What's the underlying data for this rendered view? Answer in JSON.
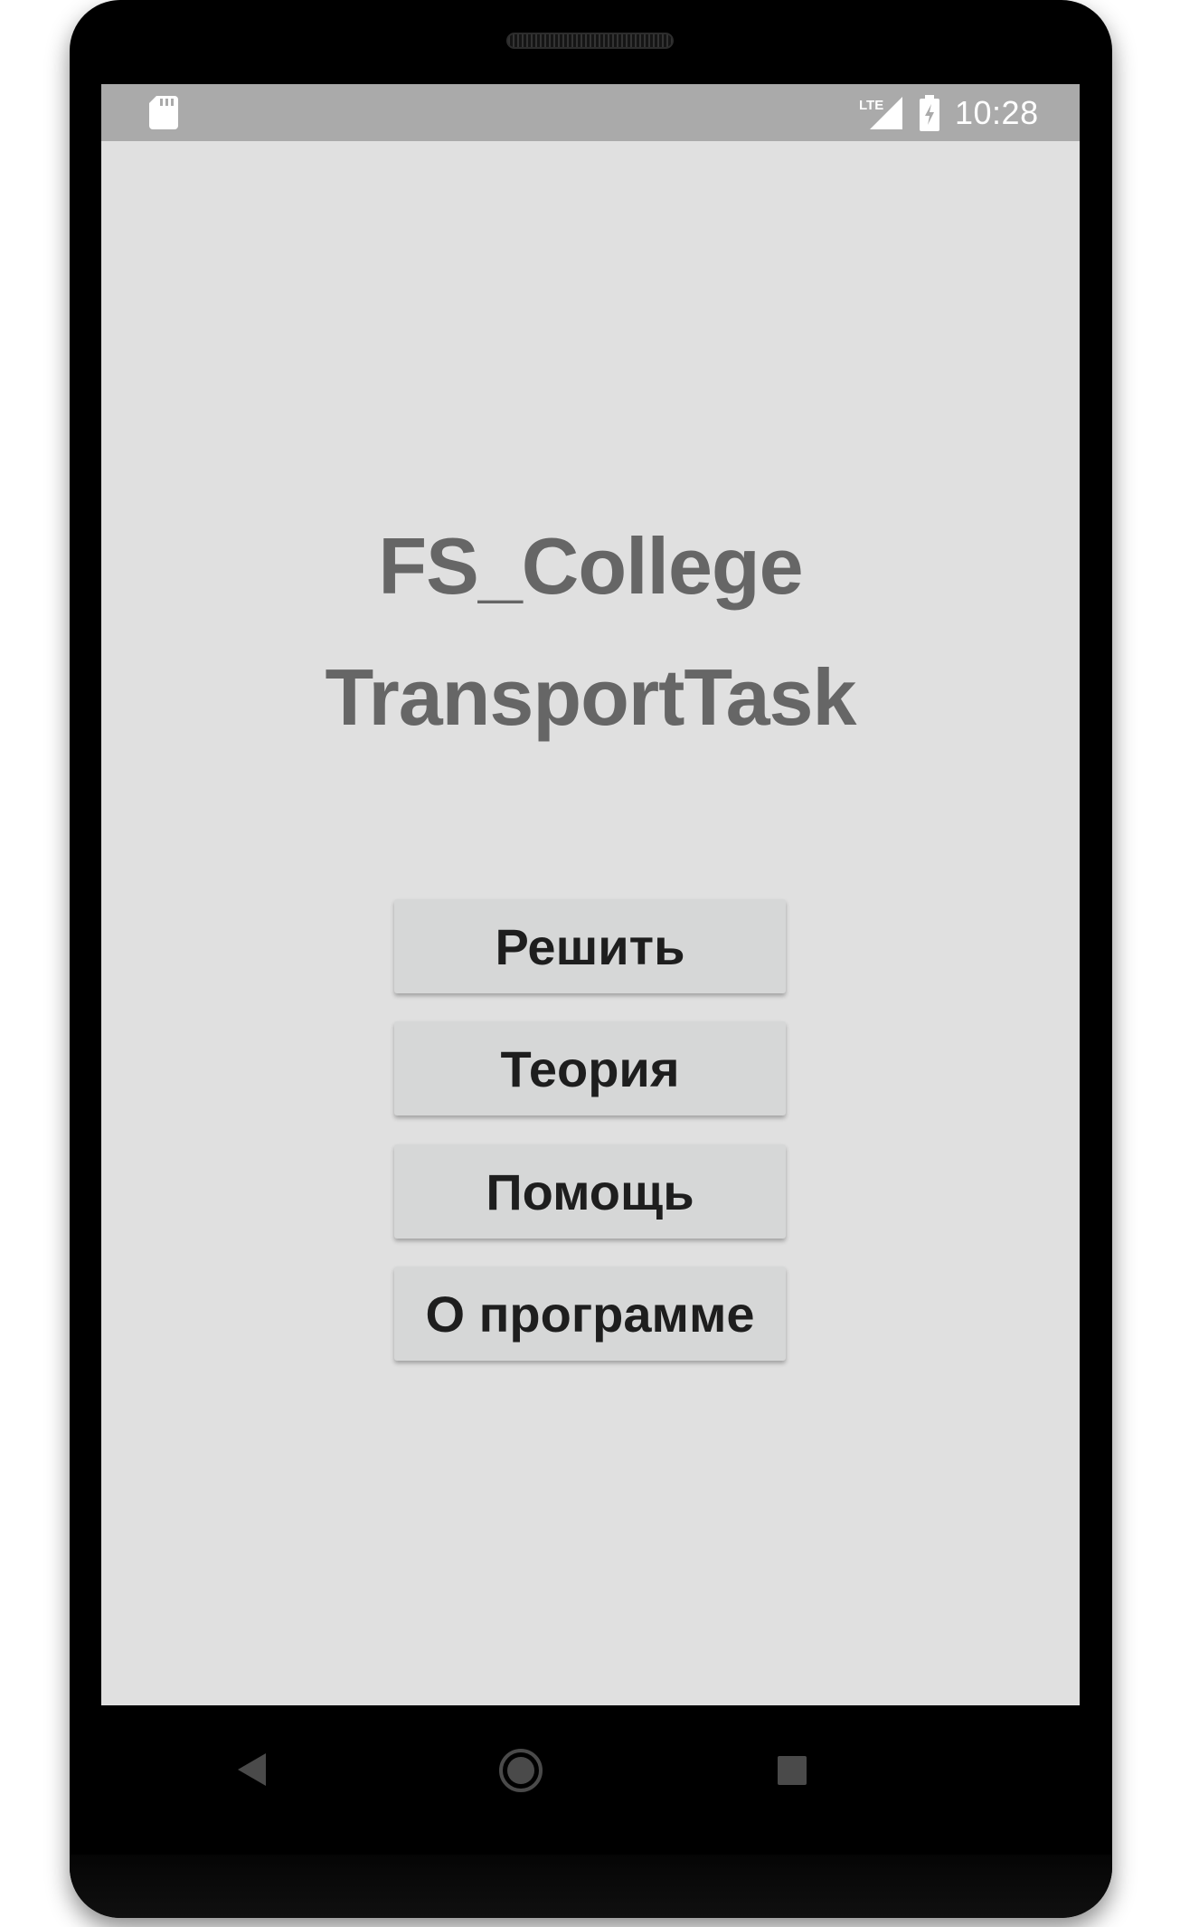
{
  "status_bar": {
    "time": "10:28",
    "network_label": "LTE",
    "icons": [
      "sd-card-icon",
      "lte-signal-icon",
      "battery-charging-icon"
    ]
  },
  "app": {
    "title_line1": "FS_College",
    "title_line2": "TransportTask"
  },
  "menu": {
    "solve": "Решить",
    "theory": "Теория",
    "help": "Помощь",
    "about": "О программе"
  },
  "nav_bar": {
    "icons": [
      "back-icon",
      "home-icon",
      "recents-icon"
    ]
  },
  "colors": {
    "screen_background": "#e0e0e0",
    "status_bar": "#aaaaaa",
    "title_text": "#666666",
    "button_background": "#d6d7d7",
    "button_text": "#1e1e1e",
    "device_frame": "#000000"
  }
}
